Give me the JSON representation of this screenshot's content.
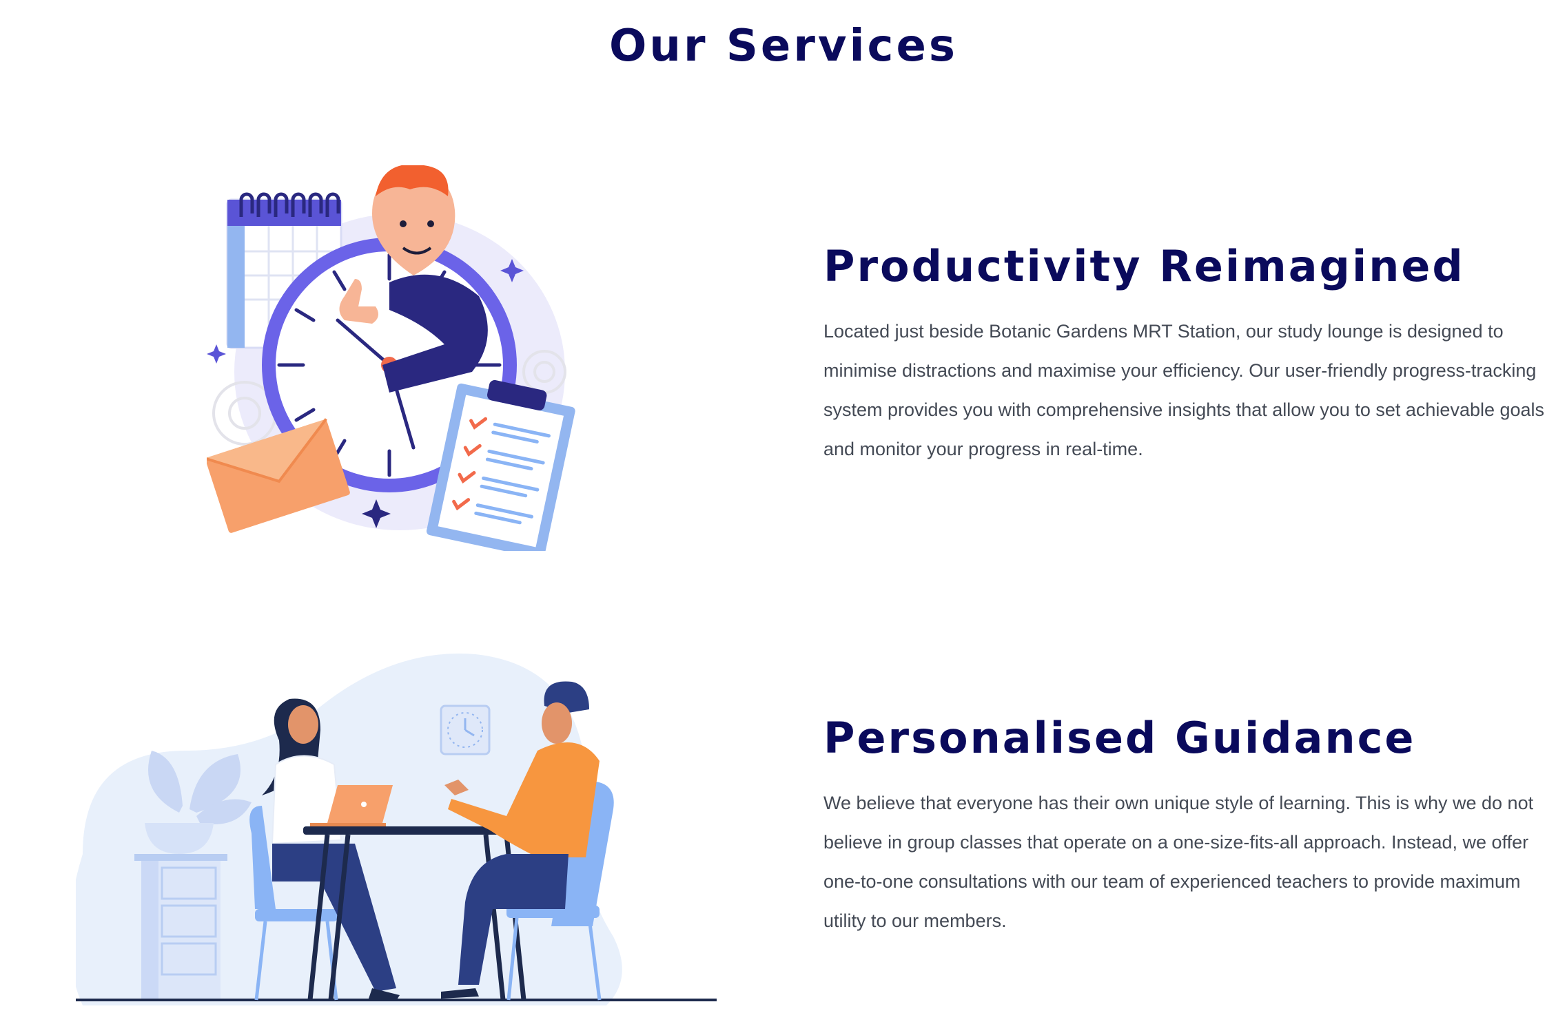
{
  "page": {
    "title": "Our Services"
  },
  "services": [
    {
      "heading": "Productivity Reimagined",
      "body": "Located just beside Botanic Gardens MRT Station, our study lounge is designed to minimise distractions and maximise your efficiency. Our user-friendly progress-tracking system provides you with comprehensive insights that allow you to set achievable goals and monitor your progress in real-time.",
      "illustration": "clock-calendar-checklist-illustration"
    },
    {
      "heading": "Personalised Guidance",
      "body": "We believe that everyone has their own unique style of learning. This is why we do not believe in group classes that operate on a one-size-fits-all approach. Instead, we offer one-to-one consultations with our team of experienced teachers to provide maximum utility to our members.",
      "illustration": "consultation-meeting-illustration"
    }
  ],
  "colors": {
    "heading": "#0a0a5c",
    "body_text": "#444a55",
    "accent_purple": "#6b63e8",
    "accent_orange": "#f7a06b",
    "accent_blue": "#8ab4f5"
  }
}
